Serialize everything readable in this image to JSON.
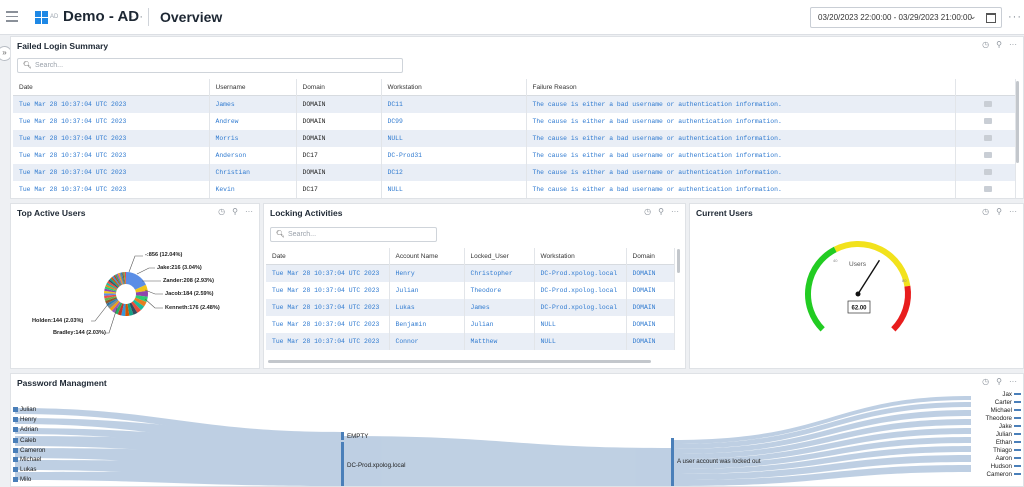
{
  "header": {
    "app_sub": "AD",
    "app_title": "Demo - AD",
    "page_title": "Overview",
    "date_range": "03/20/2023 22:00:00 - 03/29/2023 21:00:00"
  },
  "failed_login": {
    "title": "Failed Login Summary",
    "search_placeholder": "Search...",
    "columns": [
      "Date",
      "Username",
      "Domain",
      "Workstation",
      "Failure Reason"
    ],
    "rows": [
      [
        "Tue Mar 28 10:37:04 UTC 2023",
        "James",
        "DOMAIN",
        "DC11",
        "The cause is either a bad username or authentication information."
      ],
      [
        "Tue Mar 28 10:37:04 UTC 2023",
        "Andrew",
        "DOMAIN",
        "DC99",
        "The cause is either a bad username or authentication information."
      ],
      [
        "Tue Mar 28 10:37:04 UTC 2023",
        "Morris",
        "DOMAIN",
        "NULL",
        "The cause is either a bad username or authentication information."
      ],
      [
        "Tue Mar 28 10:37:04 UTC 2023",
        "Anderson",
        "DC17",
        "DC-Prod31",
        "The cause is either a bad username or authentication information."
      ],
      [
        "Tue Mar 28 10:37:04 UTC 2023",
        "Christian",
        "DOMAIN",
        "DC12",
        "The cause is either a bad username or authentication information."
      ],
      [
        "Tue Mar 28 10:37:04 UTC 2023",
        "Kevin",
        "DC17",
        "NULL",
        "The cause is either a bad username or authentication information."
      ]
    ]
  },
  "top_users": {
    "title": "Top Active Users",
    "labels": {
      "l1": "-:856 (12.04%)",
      "l2": "Jake:216 (3.04%)",
      "l3": "Zander:208 (2.93%)",
      "l4": "Jacob:184 (2.59%)",
      "l5": "Kenneth:176 (2.48%)",
      "l6": "Holden:144 (2.03%)",
      "l7": "Bradley:144 (2.03%)"
    }
  },
  "locking": {
    "title": "Locking Activities",
    "search_placeholder": "Search...",
    "columns": [
      "Date",
      "Account Name",
      "Locked_User",
      "Workstation",
      "Domain"
    ],
    "rows": [
      [
        "Tue Mar 28 10:37:04 UTC 2023",
        "Henry",
        "Christopher",
        "DC-Prod.xpolog.local",
        "DOMAIN"
      ],
      [
        "Tue Mar 28 10:37:04 UTC 2023",
        "Julian",
        "Theodore",
        "DC-Prod.xpolog.local",
        "DOMAIN"
      ],
      [
        "Tue Mar 28 10:37:04 UTC 2023",
        "Lukas",
        "James",
        "DC-Prod.xpolog.local",
        "DOMAIN"
      ],
      [
        "Tue Mar 28 10:37:04 UTC 2023",
        "Benjamin",
        "Julian",
        "NULL",
        "DOMAIN"
      ],
      [
        "Tue Mar 28 10:37:04 UTC 2023",
        "Connor",
        "Matthew",
        "NULL",
        "DOMAIN"
      ]
    ]
  },
  "current_users": {
    "title": "Current Users",
    "gauge_label": "Users",
    "value": "62.00",
    "value_num": 62,
    "tick_low": "40",
    "tick_high": "80"
  },
  "password": {
    "title": "Password Managment",
    "left_nodes": [
      "Julian",
      "Henry",
      "Adrian",
      "Caleb",
      "Cameron",
      "Michael",
      "Lukas",
      "Milo"
    ],
    "mid_nodes": [
      "EMPTY",
      "DC-Prod.xpolog.local"
    ],
    "event_node": "A user account was locked out",
    "right_nodes": [
      "Jax",
      "Carter",
      "Michael",
      "Theodore",
      "Jake",
      "Julian",
      "Ethan",
      "Thiago",
      "Aaron",
      "Hudson",
      "Cameron"
    ]
  },
  "colors": {
    "link": "#2f7ad0",
    "row_alt": "#e9eef6",
    "gauge_green": "#22cc22",
    "gauge_yellow": "#f2e21c",
    "gauge_red": "#e81d1d",
    "sankey": "#4a7fb9"
  }
}
